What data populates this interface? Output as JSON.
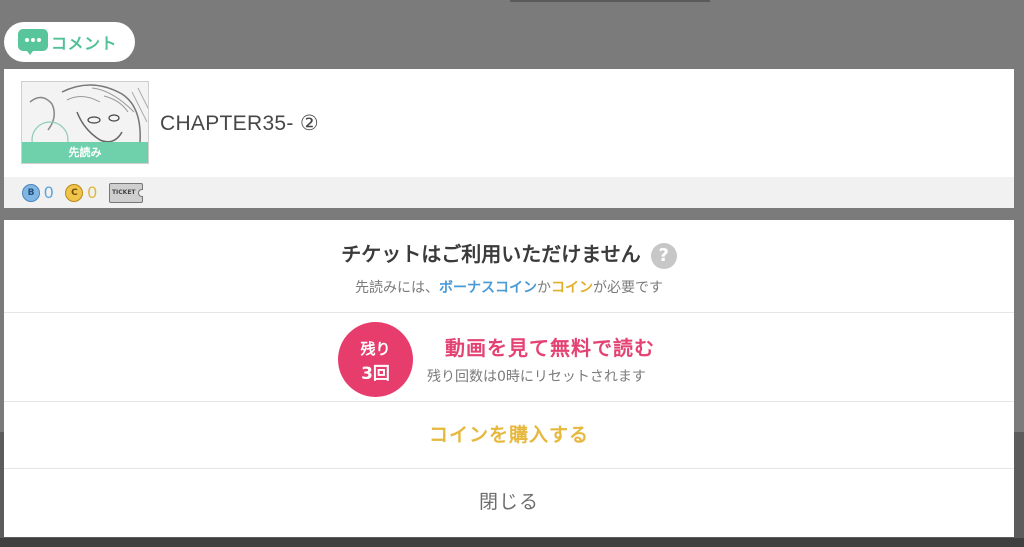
{
  "comment": {
    "label": "コメント",
    "icon": "speech-bubble-icon",
    "color": "#52c196"
  },
  "chapter": {
    "title": "CHAPTER35- ②",
    "thumbnail_badge": "先読み",
    "bonus_coin_count": "0",
    "coin_count": "0",
    "bonus_coin_letter": "B",
    "coin_letter": "C",
    "ticket_label": "TICKET"
  },
  "dialog": {
    "title": "チケットはご利用いただけません",
    "help_glyph": "?",
    "subtitle_prefix": "先読みには、",
    "bonus_coin": "ボーナスコイン",
    "conj": "か",
    "coin": "コイン",
    "subtitle_suffix": "が必要です",
    "remaining_label": "残り",
    "remaining_count": "3回",
    "video_button": "動画を見て無料で読む",
    "reset_note": "残り回数は0時にリセットされます",
    "buy_button": "コインを購入する",
    "close_button": "閉じる"
  },
  "colors": {
    "accent_pink": "#e63d6d",
    "coin_yellow": "#e6b83d",
    "bonus_blue": "#4a9ad6",
    "overlay": "#7b7b7b"
  }
}
